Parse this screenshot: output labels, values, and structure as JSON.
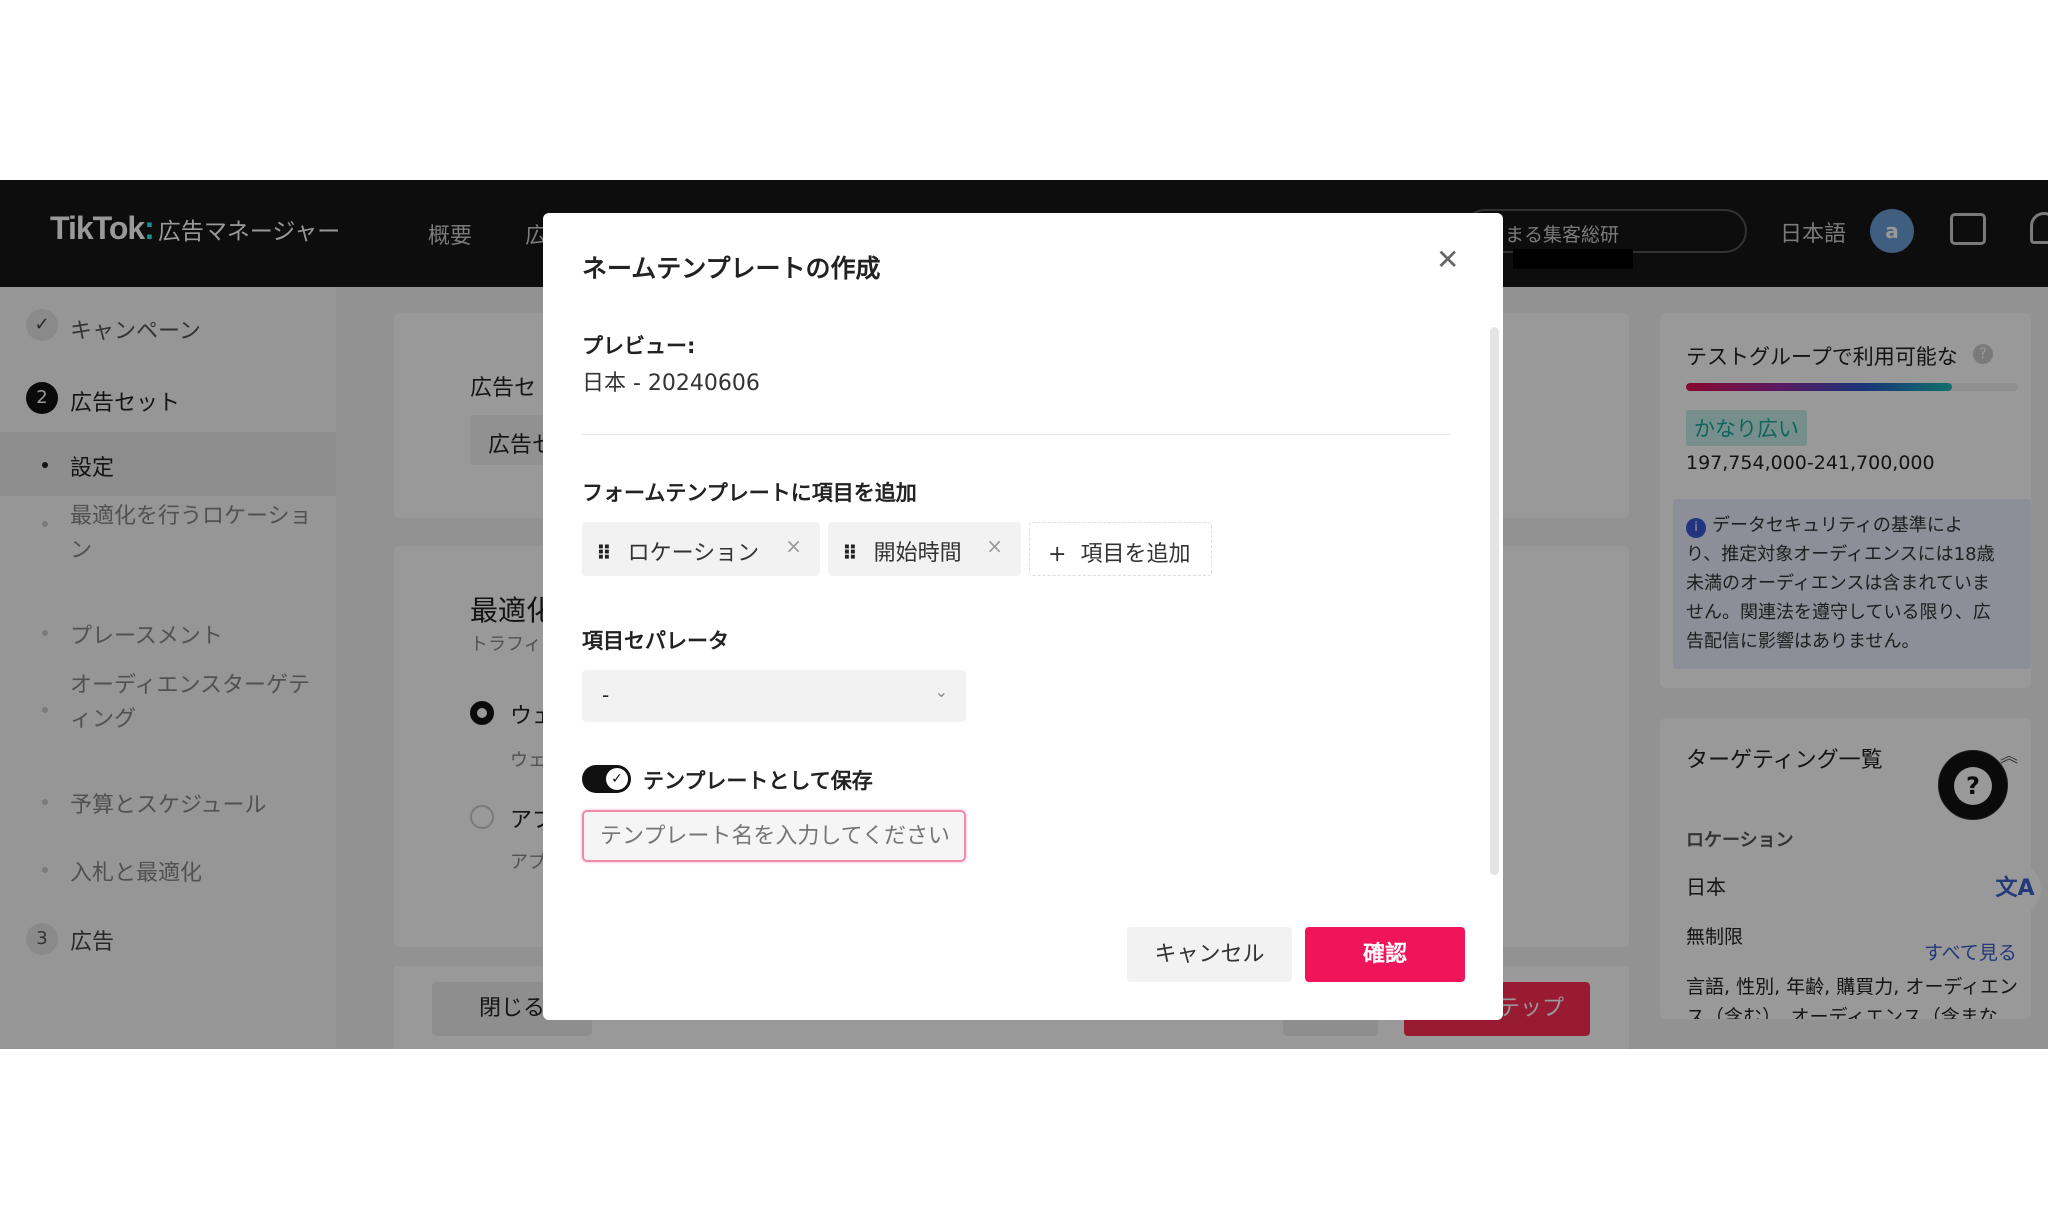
{
  "header": {
    "logo": "TikTok",
    "logo_sub": "広告マネージャー",
    "nav": [
      "概要",
      "広"
    ],
    "account": "まる集客総研",
    "language": "日本語",
    "avatar": "a"
  },
  "sidebar": {
    "items": [
      {
        "label": "キャンペーン",
        "state": "done"
      },
      {
        "label": "広告セット",
        "step": "2"
      },
      {
        "label": "設定",
        "active": true
      },
      {
        "label": "最適化を行うロケーショ",
        "label2": "ン"
      },
      {
        "label": "プレースメント"
      },
      {
        "label": "オーディエンスターゲテ",
        "label2": "ィング"
      },
      {
        "label": "予算とスケジュール"
      },
      {
        "label": "入札と最適化"
      },
      {
        "label": "広告",
        "step": "3"
      }
    ]
  },
  "main": {
    "adset_label": "広告セ",
    "adset_input": "広告セ",
    "opt_title": "最適化",
    "opt_sub": "トラフィ",
    "radio1": "ウェ",
    "radio1_sub": "ウェ",
    "radio2": "アプ",
    "radio2_sub": "アプ",
    "close_btn": "閉じる",
    "next_btn": "次のステップ"
  },
  "right": {
    "audience_title": "テストグループで利用可能な",
    "audience_level": 0.8,
    "audience_badge": "かなり広い",
    "audience_range": "197,754,000-241,700,000",
    "info_lines": [
      "データセキュリティの基準によ",
      "り、推定対象オーディエンスには18歳",
      "未満のオーディエンスは含まれていま",
      "せん。関連法を遵守している限り、広",
      "告配信に影響はありません。"
    ],
    "targeting_title": "ターゲティング一覧",
    "location_label": "ロケーション",
    "location_value": "日本",
    "unlimited": "無制限",
    "see_all": "すべて見る",
    "details_line1": "言語, 性別, 年齢, 購買力, オーディエン",
    "details_line2": "ス（含む）、オーディエンス（含まな"
  },
  "modal": {
    "title": "ネームテンプレートの作成",
    "preview_label": "プレビュー:",
    "preview_value": "日本 - 20240606",
    "fields_label": "フォームテンプレートに項目を追加",
    "chips": [
      "ロケーション",
      "開始時間"
    ],
    "add_item": "項目を追加",
    "separator_label": "項目セパレータ",
    "separator_value": "-",
    "save_toggle_label": "テンプレートとして保存",
    "save_toggle_on": true,
    "template_name_placeholder": "テンプレート名を入力してください",
    "cancel": "キャンセル",
    "confirm": "確認"
  },
  "colors": {
    "brand": "#fe2c55",
    "confirm": "#f0145a",
    "link": "#3c5fc8",
    "teal": "#20b2aa"
  }
}
